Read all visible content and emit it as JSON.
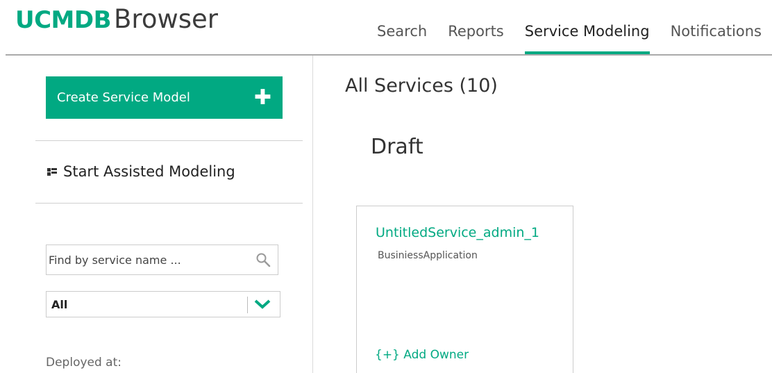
{
  "app": {
    "logo_bold": "UCMDB",
    "logo_light": "Browser"
  },
  "nav": {
    "tabs": [
      {
        "label": "Search",
        "active": false
      },
      {
        "label": "Reports",
        "active": false
      },
      {
        "label": "Service Modeling",
        "active": true
      },
      {
        "label": "Notifications",
        "active": false
      }
    ]
  },
  "sidebar": {
    "create_label": "Create Service Model",
    "assisted_label": "Start Assisted Modeling",
    "search_placeholder": "Find by service name ...",
    "filter_value": "All",
    "deployed_label": "Deployed at:"
  },
  "main": {
    "title": "All Services (10)",
    "section": "Draft",
    "cards": [
      {
        "name": "UntitledService_admin_1",
        "type": "BusiniessApplication",
        "owner_link": "{+} Add Owner"
      }
    ]
  },
  "colors": {
    "accent": "#01a982",
    "text": "#333333",
    "border": "#cccccc"
  },
  "icons": {
    "create": "plus-icon",
    "assisted": "grid-icon",
    "search": "search-icon",
    "filter": "chevron-down-icon"
  }
}
